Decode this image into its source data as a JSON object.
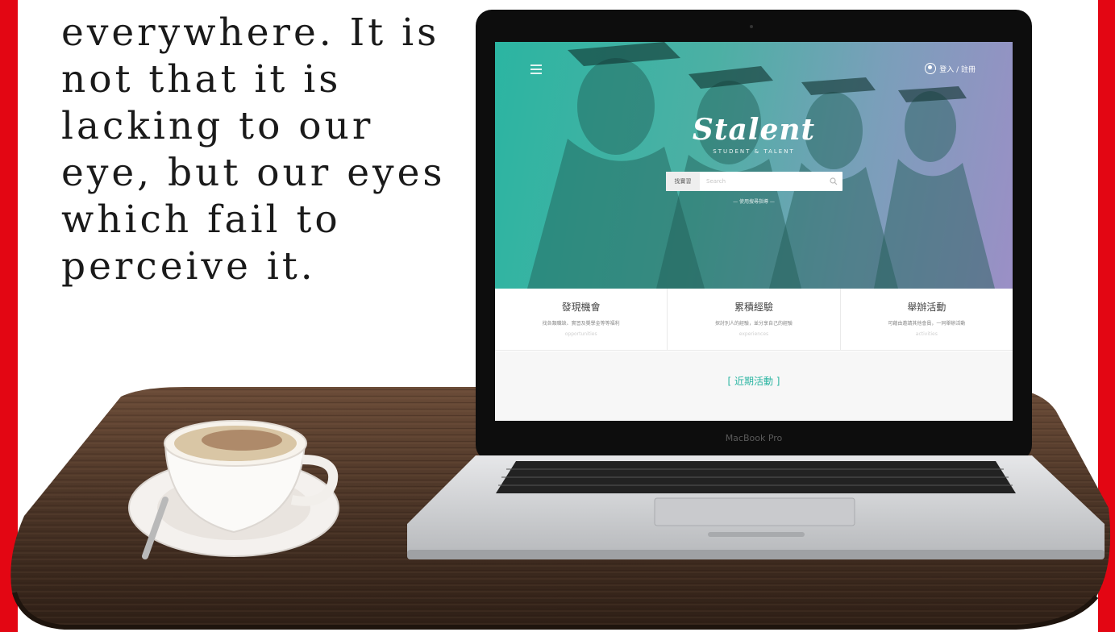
{
  "quote": {
    "text": "everywhere. It is\nnot that it is\nlacking to our\neye, but our eyes\nwhich fail to\nperceive it."
  },
  "laptop": {
    "brand": "MacBook Pro"
  },
  "website": {
    "header": {
      "login_label": "登入 / 註冊"
    },
    "hero": {
      "logo": "Stalent",
      "tagline": "STUDENT & TALENT",
      "search": {
        "category": "找實習",
        "placeholder": "Search"
      },
      "guide_link": "— 使用搜尋指導 —"
    },
    "features": [
      {
        "title": "發現機會",
        "desc": "找各類職缺、實習及獎學金等等福利",
        "en": "opportunities"
      },
      {
        "title": "累積經驗",
        "desc": "探討別人的經驗，並分享自己的經驗",
        "en": "experiences"
      },
      {
        "title": "舉辦活動",
        "desc": "可藉由邀請其他會員，一同舉辦活動",
        "en": "activities"
      }
    ],
    "recent": {
      "title": "[ 近期活動 ]"
    }
  },
  "colors": {
    "frame": "#e30613",
    "teal": "#2bb5a2",
    "purple": "#9b8fc6",
    "wood": "#4a3426"
  }
}
